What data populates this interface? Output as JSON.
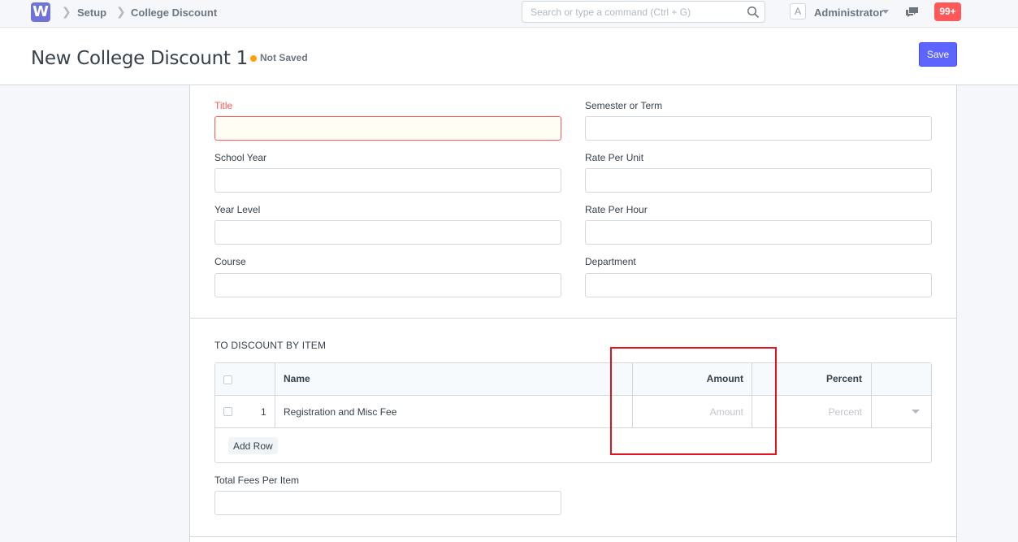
{
  "navbar": {
    "logo_letter": "W",
    "breadcrumbs": [
      "Setup",
      "College Discount"
    ],
    "search_placeholder": "Search or type a command (Ctrl + G)",
    "avatar_letter": "A",
    "user_name": "Administrator",
    "notifications": "99+"
  },
  "page": {
    "title": "New College Discount 1",
    "status": "Not Saved",
    "save_label": "Save"
  },
  "form": {
    "fields": {
      "title": "Title",
      "semester": "Semester or Term",
      "school_year": "School Year",
      "rate_per_unit": "Rate Per Unit",
      "year_level": "Year Level",
      "rate_per_hour": "Rate Per Hour",
      "course": "Course",
      "department": "Department",
      "total_fees": "Total Fees Per Item"
    },
    "section_title": "TO DISCOUNT BY ITEM",
    "grid": {
      "columns": {
        "name": "Name",
        "amount": "Amount",
        "percent": "Percent"
      },
      "rows": [
        {
          "idx": "1",
          "name": "Registration and Misc Fee",
          "amount_placeholder": "Amount",
          "percent_placeholder": "Percent"
        }
      ],
      "add_row_label": "Add Row"
    }
  },
  "colors": {
    "accent": "#5e64ff",
    "error": "#ff5858",
    "highlight": "#e0141e",
    "status_dot": "#ffa00a"
  }
}
